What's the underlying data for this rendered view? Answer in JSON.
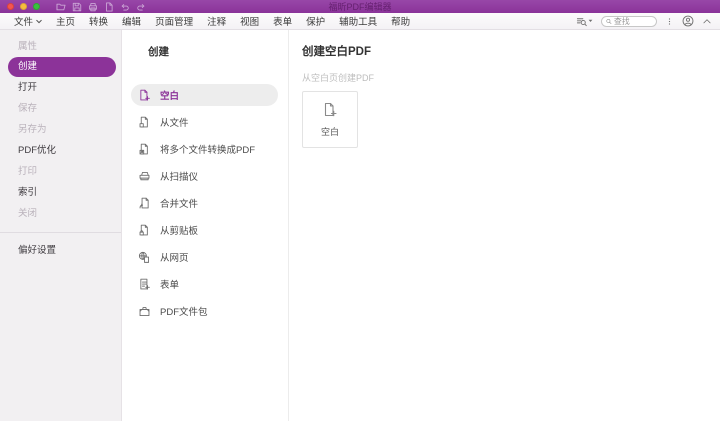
{
  "colors": {
    "titlebar_purple": "#8e3a9e",
    "accent_purple": "#8c3399",
    "selected_row_bg": "#ededed",
    "sidebar_bg": "#f2f0f2"
  },
  "window": {
    "title": "福昕PDF编辑器",
    "traffic_lights": [
      "close",
      "minimize",
      "zoom"
    ],
    "quick_access_icons": [
      "open-folder",
      "save",
      "print",
      "new-document",
      "undo",
      "redo"
    ]
  },
  "menubar": {
    "items": [
      {
        "label": "文件",
        "has_caret": true
      },
      {
        "label": "主页"
      },
      {
        "label": "转换"
      },
      {
        "label": "编辑"
      },
      {
        "label": "页面管理"
      },
      {
        "label": "注释"
      },
      {
        "label": "视图"
      },
      {
        "label": "表单"
      },
      {
        "label": "保护"
      },
      {
        "label": "辅助工具"
      },
      {
        "label": "帮助"
      }
    ],
    "right_icons": [
      "find-replace",
      "more-options",
      "account",
      "collapse-toolbar"
    ],
    "search": {
      "placeholder": "查找"
    }
  },
  "sidebar": {
    "items": [
      {
        "label": "属性",
        "state": "disabled"
      },
      {
        "label": "创建",
        "state": "selected"
      },
      {
        "label": "打开",
        "state": "normal"
      },
      {
        "label": "保存",
        "state": "disabled"
      },
      {
        "label": "另存为",
        "state": "disabled"
      },
      {
        "label": "PDF优化",
        "state": "normal"
      },
      {
        "label": "打印",
        "state": "disabled"
      },
      {
        "label": "索引",
        "state": "normal"
      },
      {
        "label": "关闭",
        "state": "disabled"
      }
    ],
    "footer_item": {
      "label": "偏好设置",
      "state": "normal"
    }
  },
  "create_panel": {
    "title": "创建",
    "items": [
      {
        "label": "空白",
        "icon": "blank-page-icon",
        "selected": true
      },
      {
        "label": "从文件",
        "icon": "from-file-icon",
        "selected": false
      },
      {
        "label": "将多个文件转换成PDF",
        "icon": "convert-multiple-icon",
        "selected": false
      },
      {
        "label": "从扫描仪",
        "icon": "scanner-icon",
        "selected": false
      },
      {
        "label": "合并文件",
        "icon": "combine-files-icon",
        "selected": false
      },
      {
        "label": "从剪贴板",
        "icon": "clipboard-icon",
        "selected": false
      },
      {
        "label": "从网页",
        "icon": "webpage-icon",
        "selected": false
      },
      {
        "label": "表单",
        "icon": "form-icon",
        "selected": false
      },
      {
        "label": "PDF文件包",
        "icon": "portfolio-icon",
        "selected": false
      }
    ]
  },
  "detail_panel": {
    "title": "创建空白PDF",
    "subtitle": "从空白页创建PDF",
    "card": {
      "label": "空白",
      "icon": "blank-page-icon"
    }
  }
}
